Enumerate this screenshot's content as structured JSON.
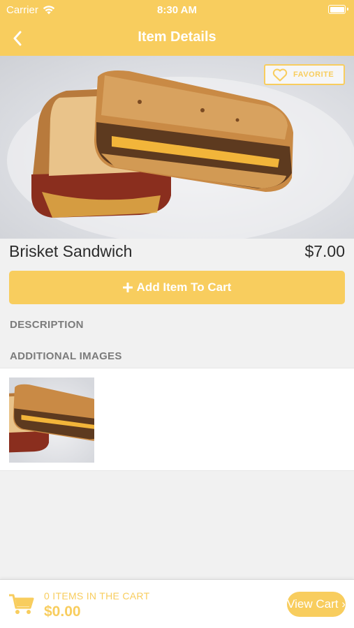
{
  "status_bar": {
    "carrier": "Carrier",
    "time": "8:30 AM"
  },
  "nav": {
    "title": "Item Details",
    "back_icon": "chevron-left-icon"
  },
  "colors": {
    "accent": "#f8cd5e",
    "text_dark": "#2b2b2b",
    "section_gray": "#7b7b7b",
    "background": "#f1f1f1"
  },
  "hero": {
    "favorite_label": "FAVORITE",
    "favorite_icon": "heart-outline-icon"
  },
  "item": {
    "name": "Brisket Sandwich",
    "price": "$7.00"
  },
  "actions": {
    "add_to_cart_label": "Add Item To Cart",
    "add_icon": "plus-icon"
  },
  "sections": {
    "description": "DESCRIPTION",
    "additional_images": "ADDITIONAL IMAGES"
  },
  "footer": {
    "items_in_cart": "0 ITEMS IN THE CART",
    "total": "$0.00",
    "view_cart_label": "View Cart ›",
    "cart_icon": "shopping-cart-icon"
  }
}
